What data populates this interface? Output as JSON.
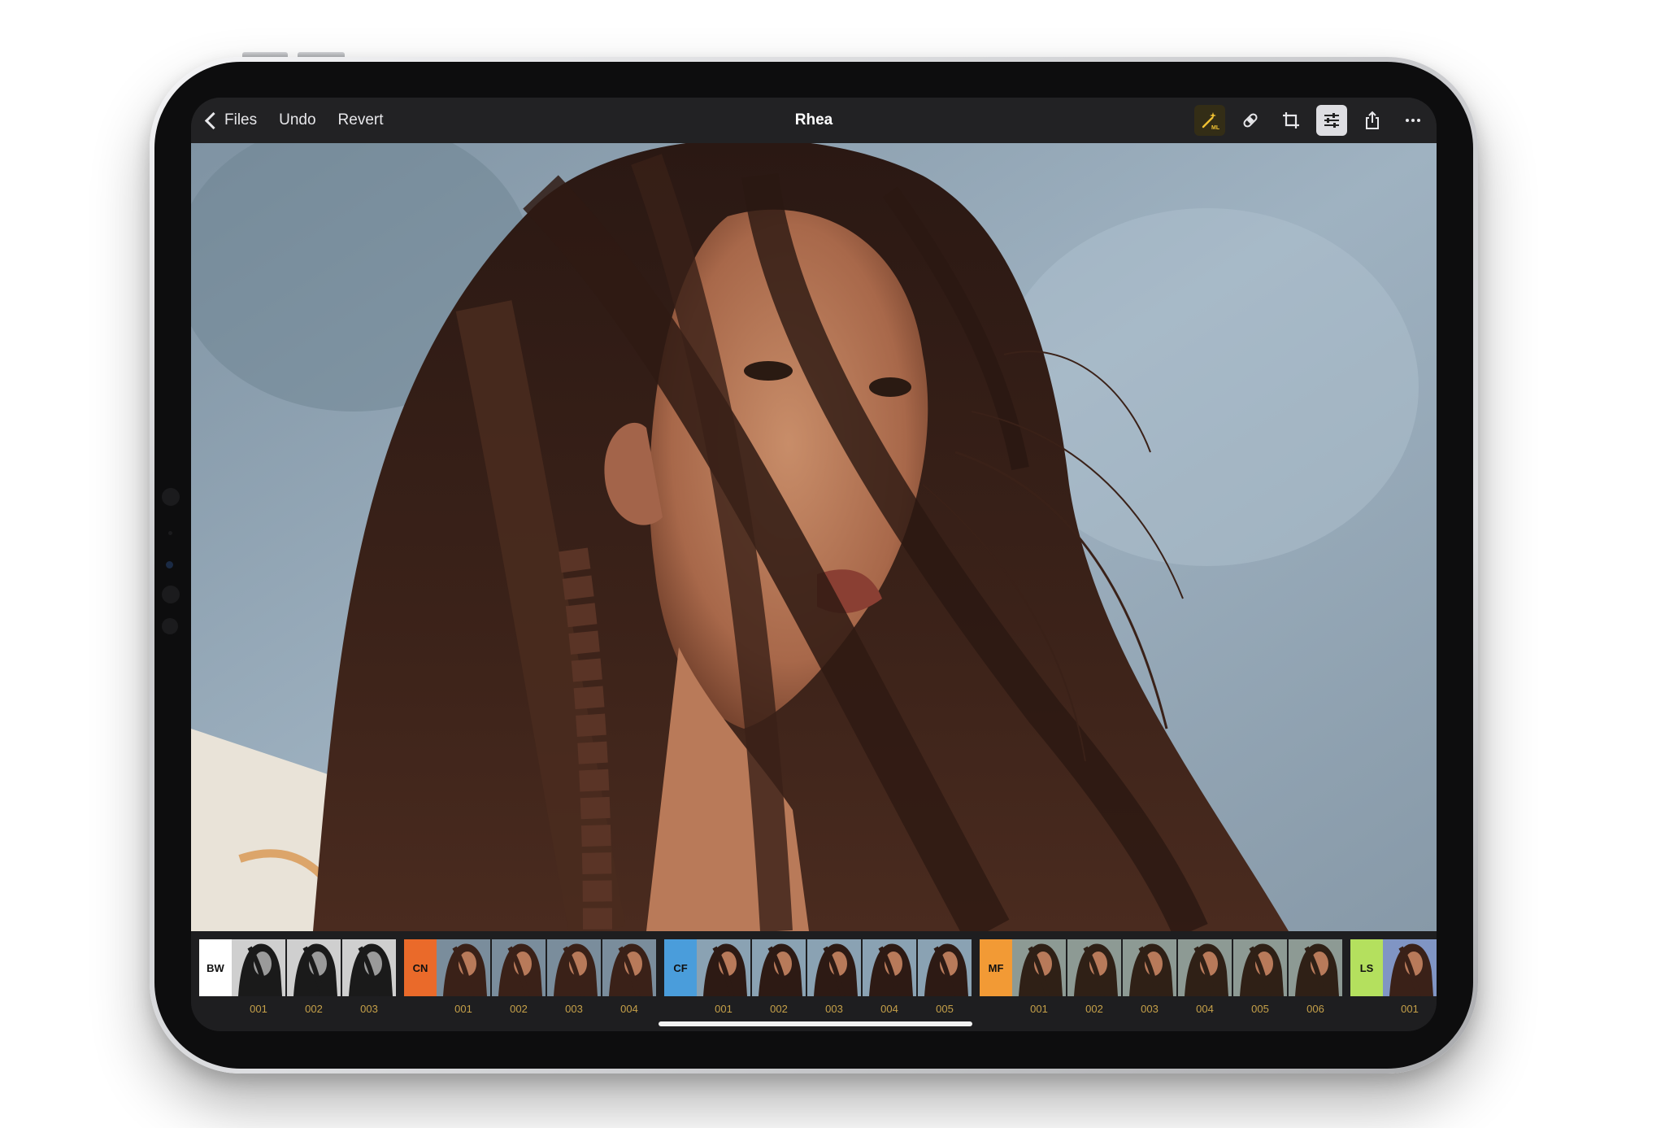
{
  "toolbar": {
    "back_label": "Files",
    "undo_label": "Undo",
    "revert_label": "Revert",
    "title": "Rhea",
    "icons": [
      "magic-wand-ml-icon",
      "repair-bandage-icon",
      "crop-icon",
      "adjust-sliders-icon",
      "share-icon",
      "more-icon"
    ],
    "ml_badge": "ML"
  },
  "colors": {
    "accent": "#f1c232",
    "bw_group": "#ffffff",
    "cn_group": "#ea6a2a",
    "cf_group": "#4a9ddb",
    "mf_group": "#f29a35",
    "ls_group": "#b4e05e"
  },
  "filter_groups": [
    {
      "code": "BW",
      "items": [
        "001",
        "002",
        "003"
      ]
    },
    {
      "code": "CN",
      "items": [
        "001",
        "002",
        "003",
        "004"
      ]
    },
    {
      "code": "CF",
      "items": [
        "001",
        "002",
        "003",
        "004",
        "005"
      ]
    },
    {
      "code": "MF",
      "items": [
        "001",
        "002",
        "003",
        "004",
        "005",
        "006"
      ]
    },
    {
      "code": "LS",
      "items": [
        "001"
      ]
    }
  ]
}
